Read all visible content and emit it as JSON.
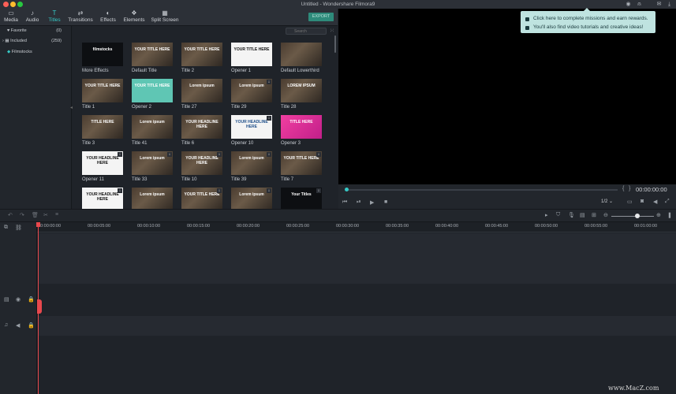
{
  "window": {
    "title": "Untitled - Wondershare Filmora9"
  },
  "nav_tabs": [
    {
      "label": "Media",
      "icon": "folder-icon",
      "active": false
    },
    {
      "label": "Audio",
      "icon": "music-note-icon",
      "active": false
    },
    {
      "label": "Titles",
      "icon": "text-T-icon",
      "active": true
    },
    {
      "label": "Transitions",
      "icon": "transitions-icon",
      "active": false
    },
    {
      "label": "Effects",
      "icon": "effects-icon",
      "active": false
    },
    {
      "label": "Elements",
      "icon": "elements-icon",
      "active": false
    },
    {
      "label": "Split Screen",
      "icon": "split-screen-icon",
      "active": false
    }
  ],
  "export_label": "EXPORT",
  "sidebar": {
    "items": [
      {
        "label": "Favorite",
        "count": "(0)"
      },
      {
        "label": "Included",
        "count": "(259)"
      },
      {
        "label": "Filmstocks",
        "count": ""
      }
    ]
  },
  "search": {
    "placeholder": "Search"
  },
  "library": {
    "items": [
      {
        "label": "More Effects",
        "overlay": "filmstocks",
        "style": "dark"
      },
      {
        "label": "Default Title",
        "overlay": "YOUR TITLE HERE",
        "style": "photo"
      },
      {
        "label": "Title 2",
        "overlay": "YOUR TITLE HERE",
        "style": "photo"
      },
      {
        "label": "Opener 1",
        "overlay": "YOUR TITLE HERE",
        "style": "white"
      },
      {
        "label": "Default Lowerthird",
        "overlay": "",
        "style": "photo"
      },
      {
        "label": "Title 1",
        "overlay": "YOUR TITLE HERE",
        "style": "photo"
      },
      {
        "label": "Opener 2",
        "overlay": "YOUR TITLE HERE",
        "style": "teal"
      },
      {
        "label": "Title 27",
        "overlay": "Lorem ipsum",
        "style": "photo"
      },
      {
        "label": "Title 29",
        "overlay": "Lorem ipsum",
        "style": "photo"
      },
      {
        "label": "Title 28",
        "overlay": "LOREM IPSUM",
        "style": "photo"
      },
      {
        "label": "Title 3",
        "overlay": "TITLE HERE",
        "style": "photo"
      },
      {
        "label": "Title 41",
        "overlay": "Lorem ipsum",
        "style": "photo"
      },
      {
        "label": "Title 6",
        "overlay": "YOUR HEADLINE HERE",
        "style": "photo"
      },
      {
        "label": "Opener 10",
        "overlay": "YOUR HEADLINE HERE",
        "style": "white-blue"
      },
      {
        "label": "Opener 3",
        "overlay": "TITLE HERE",
        "style": "pink"
      },
      {
        "label": "Opener 11",
        "overlay": "YOUR HEADLINE HERE",
        "style": "white-color"
      },
      {
        "label": "Title 33",
        "overlay": "Lorem ipsum",
        "style": "photo"
      },
      {
        "label": "Title 10",
        "overlay": "YOUR HEADLINE HERE",
        "style": "photo"
      },
      {
        "label": "Title 39",
        "overlay": "Lorem ipsum",
        "style": "photo"
      },
      {
        "label": "Title 7",
        "overlay": "YOUR TITLE HERE",
        "style": "photo"
      },
      {
        "label": "",
        "overlay": "YOUR HEADLINE HERE",
        "style": "white"
      },
      {
        "label": "",
        "overlay": "Lorem ipsum",
        "style": "photo"
      },
      {
        "label": "",
        "overlay": "YOUR TITLE HERE",
        "style": "photo"
      },
      {
        "label": "",
        "overlay": "Lorem ipsum",
        "style": "photo"
      },
      {
        "label": "",
        "overlay": "Your Titles",
        "style": "dark"
      }
    ]
  },
  "mission": {
    "line1": "Click here to complete missions and earn rewards.",
    "line2": "You'll also find video tutorials and creative ideas!"
  },
  "preview": {
    "timecode": "00:00:00:00",
    "ratio": "1/2"
  },
  "timeline": {
    "ticks": [
      "00:00:00:00",
      "00:00:05:00",
      "00:00:10:00",
      "00:00:15:00",
      "00:00:20:00",
      "00:00:25:00",
      "00:00:30:00",
      "00:00:35:00",
      "00:00:40:00",
      "00:00:45:00",
      "00:00:50:00",
      "00:00:55:00",
      "00:01:00:00"
    ]
  },
  "watermark": "www.MacZ.com",
  "colors": {
    "accent": "#36c9c6",
    "playhead": "#e8484d",
    "export_bg": "#2e8b7b"
  }
}
